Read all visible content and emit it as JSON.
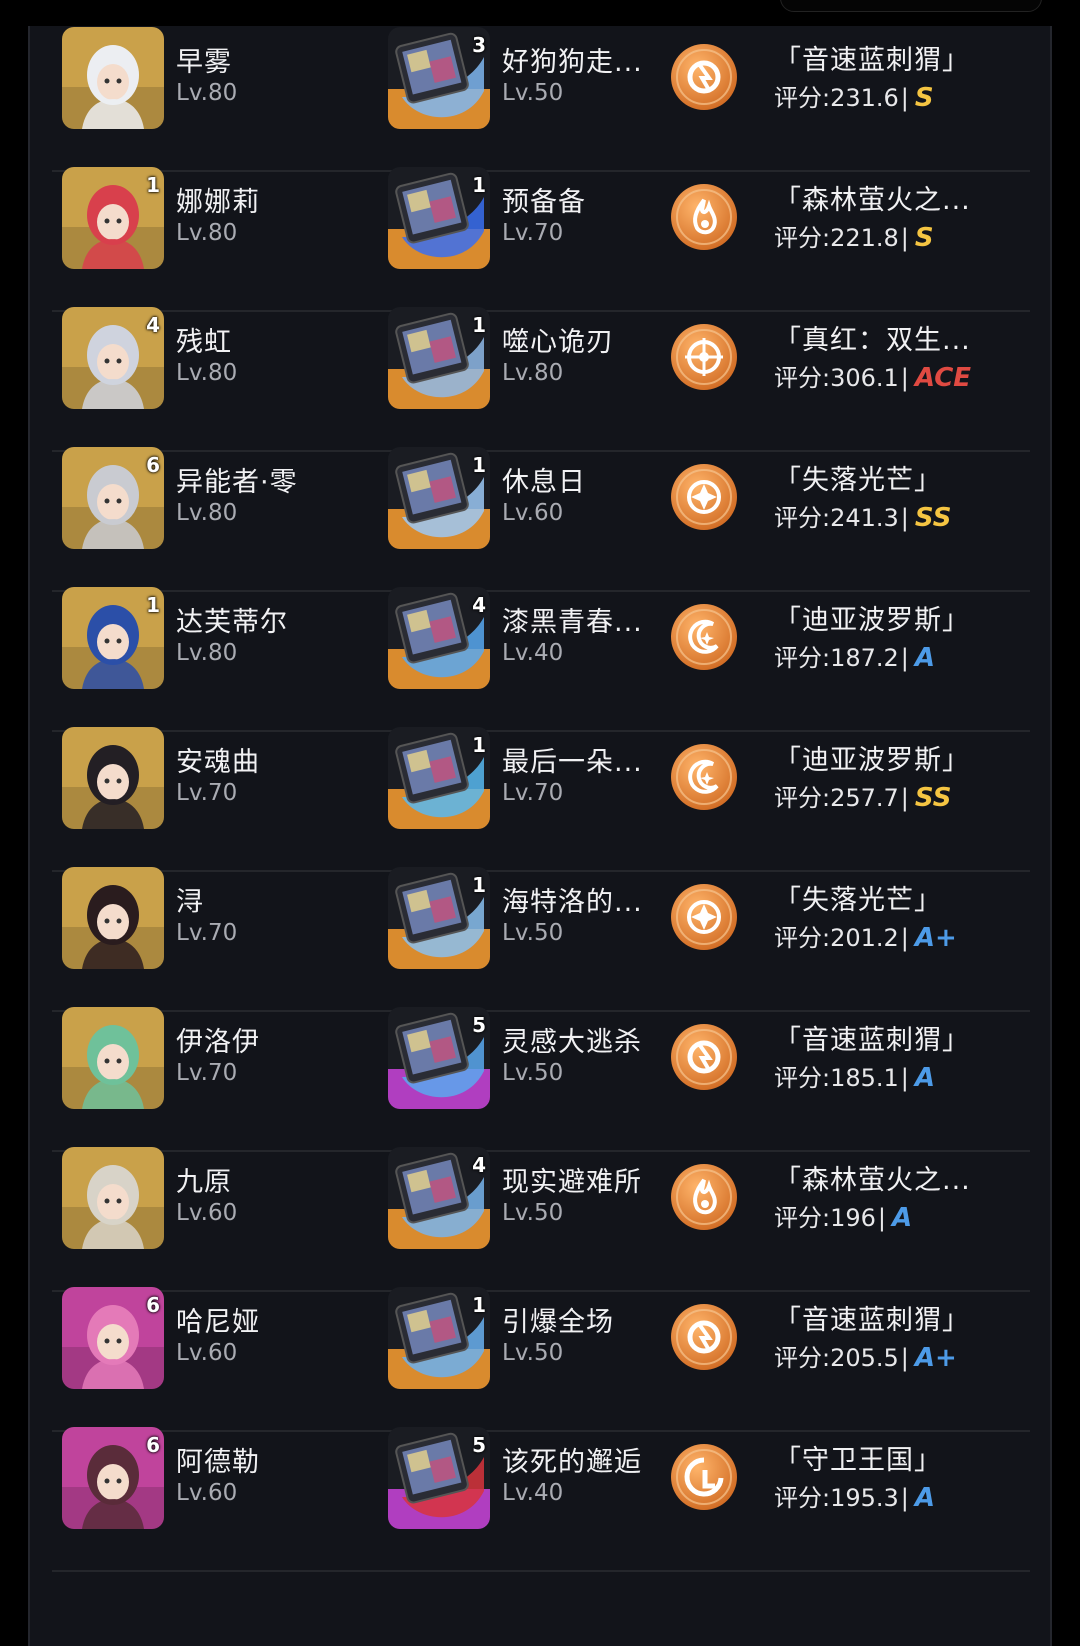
{
  "colors": {
    "panel_bg": "#12141a",
    "grade_gold": "#f5c542",
    "grade_blue": "#4d9be8",
    "grade_red": "#e04a42",
    "coin_orange": "#e98a3a"
  },
  "rows": [
    {
      "name": "早雾",
      "level": "Lv.80",
      "avatar_badge": "",
      "avatar_bg": "#caa14a",
      "weapon": "好狗狗走...",
      "weapon_level": "Lv.50",
      "weapon_badge": "3",
      "weapon_bg": "#d98b2e",
      "coin_icon": "lightning-coin-icon",
      "set": "「音速蓝刺猬」",
      "score": "评分:231.6",
      "grade": "S"
    },
    {
      "name": "娜娜莉",
      "level": "Lv.80",
      "avatar_badge": "1",
      "avatar_bg": "#c9a14a",
      "weapon": "预备备",
      "weapon_level": "Lv.70",
      "weapon_badge": "1",
      "weapon_bg": "#d98b2e",
      "coin_icon": "flame-coin-icon",
      "set": "「森林萤火之...",
      "score": "评分:221.8",
      "grade": "S"
    },
    {
      "name": "残虹",
      "level": "Lv.80",
      "avatar_badge": "4",
      "avatar_bg": "#c9a14a",
      "weapon": "噬心诡刃",
      "weapon_level": "Lv.80",
      "weapon_badge": "1",
      "weapon_bg": "#d98b2e",
      "coin_icon": "compass-coin-icon",
      "set": "「真红：双生...",
      "score": "评分:306.1",
      "grade": "ACE"
    },
    {
      "name": "异能者·零",
      "level": "Lv.80",
      "avatar_badge": "6",
      "avatar_bg": "#c9a14a",
      "weapon": "休息日",
      "weapon_level": "Lv.60",
      "weapon_badge": "1",
      "weapon_bg": "#d98b2e",
      "coin_icon": "star-coin-icon",
      "set": "「失落光芒」",
      "score": "评分:241.3",
      "grade": "SS"
    },
    {
      "name": "达芙蒂尔",
      "level": "Lv.80",
      "avatar_badge": "1",
      "avatar_bg": "#c9a14a",
      "weapon": "漆黑青春...",
      "weapon_level": "Lv.40",
      "weapon_badge": "4",
      "weapon_bg": "#d98b2e",
      "coin_icon": "moon-coin-icon",
      "set": "「迪亚波罗斯」",
      "score": "评分:187.2",
      "grade": "A"
    },
    {
      "name": "安魂曲",
      "level": "Lv.70",
      "avatar_badge": "",
      "avatar_bg": "#c9a14a",
      "weapon": "最后一朵...",
      "weapon_level": "Lv.70",
      "weapon_badge": "1",
      "weapon_bg": "#d98b2e",
      "coin_icon": "moon-coin-icon",
      "set": "「迪亚波罗斯」",
      "score": "评分:257.7",
      "grade": "SS"
    },
    {
      "name": "浔",
      "level": "Lv.70",
      "avatar_badge": "",
      "avatar_bg": "#c9a14a",
      "weapon": "海特洛的...",
      "weapon_level": "Lv.50",
      "weapon_badge": "1",
      "weapon_bg": "#d98b2e",
      "coin_icon": "star-coin-icon",
      "set": "「失落光芒」",
      "score": "评分:201.2",
      "grade": "A+"
    },
    {
      "name": "伊洛伊",
      "level": "Lv.70",
      "avatar_badge": "",
      "avatar_bg": "#c9a14a",
      "weapon": "灵感大逃杀",
      "weapon_level": "Lv.50",
      "weapon_badge": "5",
      "weapon_bg": "#b03ec0",
      "coin_icon": "lightning-coin-icon",
      "set": "「音速蓝刺猬」",
      "score": "评分:185.1",
      "grade": "A"
    },
    {
      "name": "九原",
      "level": "Lv.60",
      "avatar_badge": "",
      "avatar_bg": "#c9a14a",
      "weapon": "现实避难所",
      "weapon_level": "Lv.50",
      "weapon_badge": "4",
      "weapon_bg": "#d98b2e",
      "coin_icon": "flame-coin-icon",
      "set": "「森林萤火之...",
      "score": "评分:196",
      "grade": "A"
    },
    {
      "name": "哈尼娅",
      "level": "Lv.60",
      "avatar_badge": "6",
      "avatar_bg": "#c0449c",
      "weapon": "引爆全场",
      "weapon_level": "Lv.50",
      "weapon_badge": "1",
      "weapon_bg": "#d98b2e",
      "coin_icon": "lightning-coin-icon",
      "set": "「音速蓝刺猬」",
      "score": "评分:205.5",
      "grade": "A+"
    },
    {
      "name": "阿德勒",
      "level": "Lv.60",
      "avatar_badge": "6",
      "avatar_bg": "#c0449c",
      "weapon": "该死的邂逅",
      "weapon_level": "Lv.40",
      "weapon_badge": "5",
      "weapon_bg": "#b03ec0",
      "coin_icon": "shield-coin-icon",
      "set": "「守卫王国」",
      "score": "评分:195.3",
      "grade": "A"
    }
  ]
}
